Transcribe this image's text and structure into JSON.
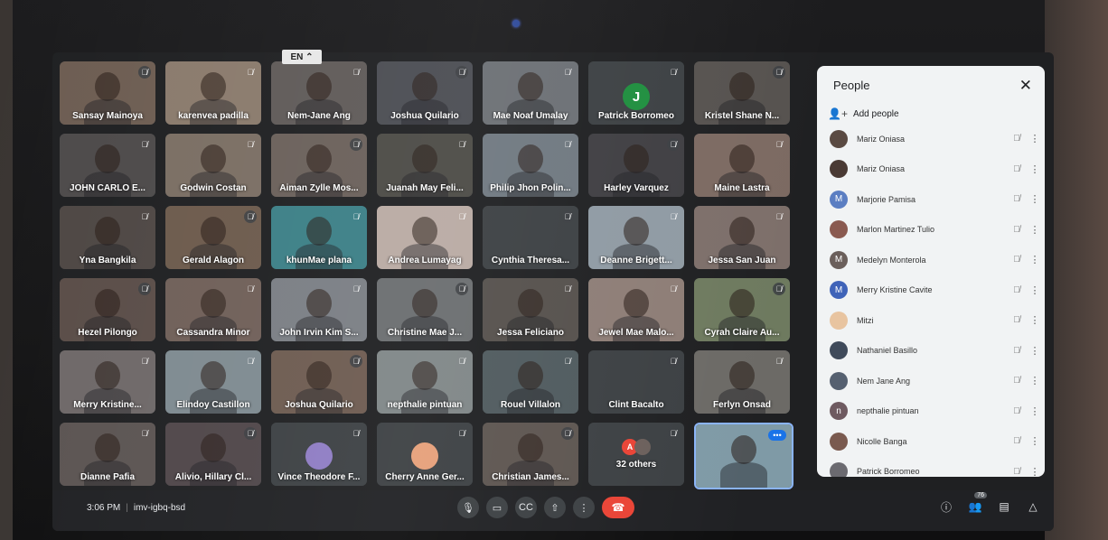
{
  "language_badge": "EN",
  "tiles": [
    {
      "name": "Sansay Mainoya",
      "bg": "#6d5d52"
    },
    {
      "name": "karenvea padilla",
      "bg": "#8a7a6c"
    },
    {
      "name": "Nem-Jane Ang",
      "bg": "#5f5a58"
    },
    {
      "name": "Joshua Quilario",
      "bg": "#4a4c52"
    },
    {
      "name": "Mae Noaf Umalay",
      "bg": "#6b6f74"
    },
    {
      "name": "Patrick Borromeo",
      "bg": "#3c4043",
      "avatar": "J"
    },
    {
      "name": "Kristel Shane N...",
      "bg": "#56524f"
    },
    {
      "name": "JOHN CARLO E...",
      "bg": "#4d4a4a"
    },
    {
      "name": "Godwin Costan",
      "bg": "#7a6e63"
    },
    {
      "name": "Aiman Zylle Mos...",
      "bg": "#6a605a"
    },
    {
      "name": "Juanah May Feli...",
      "bg": "#4b4a45"
    },
    {
      "name": "Philip Jhon Polin...",
      "bg": "#6f7880"
    },
    {
      "name": "Harley Varquez",
      "bg": "#3f3e42"
    },
    {
      "name": "Maine Lastra",
      "bg": "#7c6a62"
    },
    {
      "name": "Yna Bangkila",
      "bg": "#4e4744"
    },
    {
      "name": "Gerald Alagon",
      "bg": "#6c5a4c"
    },
    {
      "name": "khunMae plana",
      "bg": "#3b7f86"
    },
    {
      "name": "Andrea Lumayag",
      "bg": "#b9aaa3"
    },
    {
      "name": "Cynthia Theresa...",
      "bg": "#3c4043"
    },
    {
      "name": "Deanne Brigett...",
      "bg": "#8f9aa3"
    },
    {
      "name": "Jessa San Juan",
      "bg": "#7d6f6a"
    },
    {
      "name": "Hezel Pilongo",
      "bg": "#5a4d48"
    },
    {
      "name": "Cassandra Minor",
      "bg": "#6f5f58"
    },
    {
      "name": "John Irvin Kim S...",
      "bg": "#7a7e84"
    },
    {
      "name": "Christine Mae J...",
      "bg": "#6a6d6f"
    },
    {
      "name": "Jessa Feliciano",
      "bg": "#55504c"
    },
    {
      "name": "Jewel Mae Malo...",
      "bg": "#8d7d76"
    },
    {
      "name": "Cyrah Claire Au...",
      "bg": "#6e7a5f"
    },
    {
      "name": "Merry Kristine...",
      "bg": "#6e6868"
    },
    {
      "name": "Elindoy Castillon",
      "bg": "#7e8a90"
    },
    {
      "name": "Joshua Quilario",
      "bg": "#6d5b50"
    },
    {
      "name": "nepthalie pintuan",
      "bg": "#7f8687"
    },
    {
      "name": "Rouel Villalon",
      "bg": "#4f5a5e"
    },
    {
      "name": "Clint Bacalto",
      "bg": "#3c4043"
    },
    {
      "name": "Ferlyn Onsad",
      "bg": "#6c6a66"
    },
    {
      "name": "Dianne Pafia",
      "bg": "#5b5452"
    },
    {
      "name": "Alivio, Hillary Cl...",
      "bg": "#4f4649"
    },
    {
      "name": "Vince Theodore F...",
      "bg": "#3c4043",
      "img": "#8e7cc3"
    },
    {
      "name": "Cherry Anne Ger...",
      "bg": "#3c4043",
      "img": "#e6a07a"
    },
    {
      "name": "Christian James...",
      "bg": "#5d5550"
    },
    {
      "name": "32 others",
      "bg": "#3c4043",
      "others": true
    },
    {
      "name": "",
      "bg": "#7f9aa6",
      "self": true
    }
  ],
  "people_panel": {
    "title": "People",
    "close_icon": "close-icon",
    "add_people": "Add people",
    "list": [
      {
        "name": "Mariz Oniasa",
        "avatar": "#5a4a42"
      },
      {
        "name": "Mariz Oniasa",
        "avatar": "#4a3a34"
      },
      {
        "name": "Marjorie Pamisa",
        "avatar": "#5b7ec2",
        "initial": "M"
      },
      {
        "name": "Marlon Martinez Tulio",
        "avatar": "#8a5a50"
      },
      {
        "name": "Medelyn Monterola",
        "avatar": "#6b5f5b",
        "initial": "M"
      },
      {
        "name": "Merry Kristine Cavite",
        "avatar": "#3f63b8",
        "initial": "M"
      },
      {
        "name": "Mitzi",
        "avatar": "#e8c4a0"
      },
      {
        "name": "Nathaniel Basillo",
        "avatar": "#3f4a5a"
      },
      {
        "name": "Nem Jane Ang",
        "avatar": "#556070"
      },
      {
        "name": "nepthalie pintuan",
        "avatar": "#6e5a60",
        "initial": "n"
      },
      {
        "name": "Nicolle Banga",
        "avatar": "#7a5a4f"
      },
      {
        "name": "Patrick Borromeo",
        "avatar": "#6b6a70"
      }
    ]
  },
  "bottom_bar": {
    "time": "3:06 PM",
    "separator": "|",
    "meeting_code": "imv-igbq-bsd",
    "participant_count": "76"
  }
}
